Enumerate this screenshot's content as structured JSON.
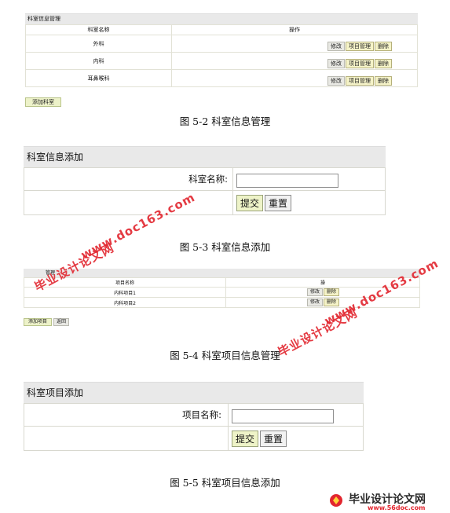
{
  "fig1": {
    "panel_title": "科室信息管理",
    "col_name": "科室名称",
    "col_ops": "操作",
    "rows": [
      {
        "name": "外科"
      },
      {
        "name": "内科"
      },
      {
        "name": "耳鼻喉科"
      }
    ],
    "btn_edit": "修改",
    "btn_project": "项目管理",
    "btn_delete": "删除",
    "add_button": "添加科室",
    "caption": "图 5-2  科室信息管理"
  },
  "fig2": {
    "panel_title": "科室信息添加",
    "field_label": "科室名称:",
    "field_value": "",
    "submit": "提交",
    "reset": "重置",
    "caption": "图 5-3  科室信息添加"
  },
  "fig3": {
    "panel_title": "管理",
    "col_name": "项目名称",
    "col_ops": "操",
    "rows": [
      {
        "name": "内科项目1"
      },
      {
        "name": "内科项目2"
      }
    ],
    "btn_edit": "修改",
    "btn_delete": "删除",
    "add_button": "添加项目",
    "back_button": "返回",
    "caption": "图 5-4  科室项目信息管理"
  },
  "fig4": {
    "panel_title": "科室项目添加",
    "field_label": "项目名称:",
    "field_value": "",
    "submit": "提交",
    "reset": "重置",
    "caption": "图 5-5  科室项目信息添加"
  },
  "watermarks": {
    "site_cn": "毕业设计论文网",
    "site_url": "www.doc163.com",
    "footer_cn": "毕业设计论文网",
    "footer_url": "www.56doc.com"
  }
}
